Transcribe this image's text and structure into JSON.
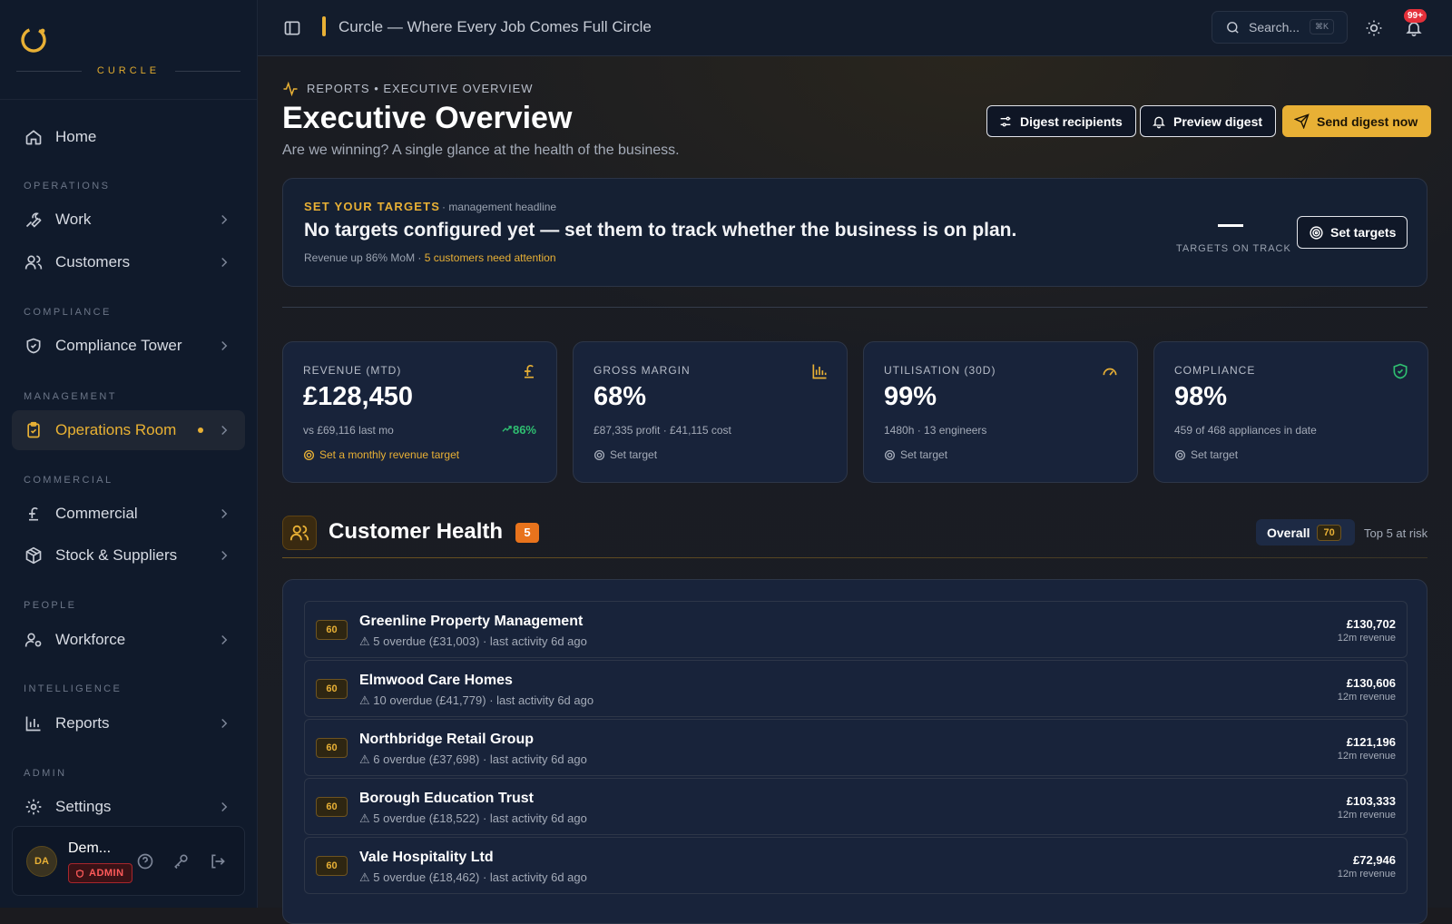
{
  "brand": {
    "name": "CURCLE"
  },
  "sidebar": {
    "sections": [
      "OPERATIONS",
      "COMPLIANCE",
      "MANAGEMENT",
      "COMMERCIAL",
      "PEOPLE",
      "INTELLIGENCE",
      "ADMIN"
    ],
    "items": [
      {
        "label": "Home",
        "icon": "home-icon"
      },
      {
        "label": "Work",
        "icon": "wrench-icon"
      },
      {
        "label": "Customers",
        "icon": "users-icon"
      },
      {
        "label": "Compliance Tower",
        "icon": "shield-icon"
      },
      {
        "label": "Operations Room",
        "icon": "clipboard-icon",
        "active": true
      },
      {
        "label": "Commercial",
        "icon": "pound-icon"
      },
      {
        "label": "Stock & Suppliers",
        "icon": "package-icon"
      },
      {
        "label": "Workforce",
        "icon": "user-cog-icon"
      },
      {
        "label": "Reports",
        "icon": "bar-chart-icon"
      },
      {
        "label": "Settings",
        "icon": "gear-icon"
      }
    ],
    "user": {
      "initials": "DA",
      "name": "Dem...",
      "role": "ADMIN"
    }
  },
  "topbar": {
    "title": "Curcle — Where Every Job Comes Full Circle",
    "search_placeholder": "Search...",
    "shortcut": "⌘K",
    "notifications": "99+"
  },
  "page": {
    "breadcrumb": "REPORTS • EXECUTIVE OVERVIEW",
    "title": "Executive Overview",
    "subtitle": "Are we winning? A single glance at the health of the business.",
    "actions": {
      "recipients": "Digest recipients",
      "preview": "Preview digest",
      "send": "Send digest now"
    }
  },
  "targets": {
    "label": "SET YOUR TARGETS",
    "label_note": "· management headline",
    "headline": "No targets configured yet — set them to track whether the business is on plan.",
    "sub_prefix": "Revenue up 86% MoM ·",
    "sub_alert": "5 customers need attention",
    "on_track_value": "—",
    "on_track_label": "TARGETS ON TRACK",
    "button": "Set targets"
  },
  "kpis": [
    {
      "label": "REVENUE (MTD)",
      "value": "£128,450",
      "sub": "vs £69,116 last mo",
      "trend": "86%",
      "target": "Set a monthly revenue target",
      "icon": "pound-icon",
      "icon_color": "#e8b035"
    },
    {
      "label": "GROSS MARGIN",
      "value": "68%",
      "sub": "£87,335 profit · £41,115 cost",
      "target": "Set target",
      "icon": "bar-chart-icon",
      "icon_color": "#e8b035"
    },
    {
      "label": "UTILISATION (30D)",
      "value": "99%",
      "sub": "1480h · 13 engineers",
      "target": "Set target",
      "icon": "gauge-icon",
      "icon_color": "#e8b035"
    },
    {
      "label": "COMPLIANCE",
      "value": "98%",
      "sub": "459 of 468 appliances in date",
      "target": "Set target",
      "icon": "shield-check-icon",
      "icon_color": "#2fbf71"
    }
  ],
  "customer_health": {
    "title": "Customer Health",
    "count": "5",
    "overall_label": "Overall",
    "overall_score": "70",
    "top_note": "Top 5 at risk",
    "rows": [
      {
        "score": "60",
        "name": "Greenline Property Management",
        "meta": "⚠ 5 overdue (£31,003) · last activity 6d ago",
        "value": "£130,702",
        "caption": "12m revenue"
      },
      {
        "score": "60",
        "name": "Elmwood Care Homes",
        "meta": "⚠ 10 overdue (£41,779) · last activity 6d ago",
        "value": "£130,606",
        "caption": "12m revenue"
      },
      {
        "score": "60",
        "name": "Northbridge Retail Group",
        "meta": "⚠ 6 overdue (£37,698) · last activity 6d ago",
        "value": "£121,196",
        "caption": "12m revenue"
      },
      {
        "score": "60",
        "name": "Borough Education Trust",
        "meta": "⚠ 5 overdue (£18,522) · last activity 6d ago",
        "value": "£103,333",
        "caption": "12m revenue"
      },
      {
        "score": "60",
        "name": "Vale Hospitality Ltd",
        "meta": "⚠ 5 overdue (£18,462) · last activity 6d ago",
        "value": "£72,946",
        "caption": "12m revenue"
      }
    ]
  },
  "colors": {
    "accent": "#e8b035",
    "positive": "#2fbf71",
    "danger": "#e5303a"
  }
}
